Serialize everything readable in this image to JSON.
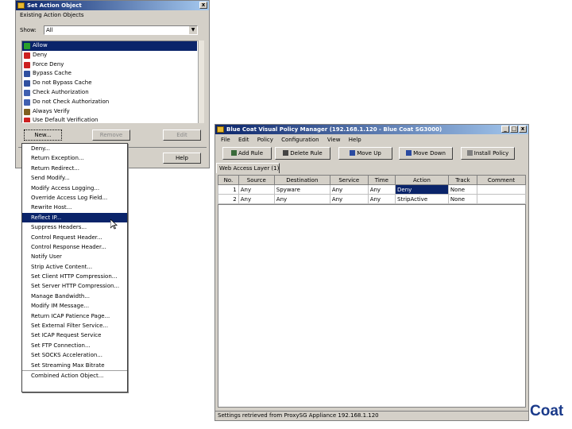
{
  "action_dialog": {
    "title": "Set Action Object",
    "group_label": "Existing Action Objects",
    "show_label": "Show:",
    "show_value": "All",
    "items": [
      "Allow",
      "Deny",
      "Force Deny",
      "Bypass Cache",
      "Do not Bypass Cache",
      "Check Authorization",
      "Do not Check Authorization",
      "Always Verify",
      "Use Default Verification"
    ],
    "selected_index": 0,
    "new_button": "New...",
    "remove_button": "Remove",
    "edit_button": "Edit",
    "help_button": "Help"
  },
  "new_menu": {
    "items": [
      "Deny...",
      "Return Exception...",
      "Return Redirect...",
      "Send Modify...",
      "Modify Access Logging...",
      "Override Access Log Field...",
      "Rewrite Host...",
      "Reflect IP...",
      "Suppress Headers...",
      "Control Request Header...",
      "Control Response Header...",
      "Notify User",
      "Strip Active Content...",
      "Set Client HTTP Compression...",
      "Set Server HTTP Compression...",
      "Manage Bandwidth...",
      "Modify IM Message...",
      "Return ICAP Patience Page...",
      "Set External Filter Service...",
      "Set ICAP Request Service",
      "Set FTP Connection...",
      "Set SOCKS Acceleration...",
      "Set Streaming Max Bitrate",
      "Combined Action Object..."
    ],
    "selected_index": 7
  },
  "vpm": {
    "title": "Blue Coat Visual Policy Manager (192.168.1.120 - Blue Coat SG3000)",
    "menu": [
      "File",
      "Edit",
      "Policy",
      "Configuration",
      "View",
      "Help"
    ],
    "toolbar": [
      "Add Rule",
      "Delete Rule",
      "Move Up",
      "Move Down",
      "Install Policy"
    ],
    "tab": "Web Access Layer (1)",
    "columns": [
      "No.",
      "Source",
      "Destination",
      "Service",
      "Time",
      "Action",
      "Track",
      "Comment"
    ],
    "rows": [
      [
        "1",
        "Any",
        "Spyware",
        "Any",
        "Any",
        "Deny",
        "None",
        ""
      ],
      [
        "2",
        "Any",
        "Any",
        "Any",
        "Any",
        "StripActive",
        "None",
        ""
      ]
    ],
    "status": "Settings retrieved from ProxySG Appliance 192.168.1.120"
  },
  "brand_text": "Coat",
  "colors": {
    "selection": "#0a246a",
    "window": "#d4d0c8",
    "brand": "#1a3a8a"
  }
}
